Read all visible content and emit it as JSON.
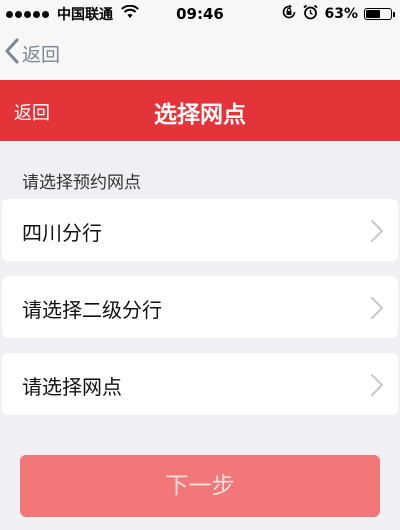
{
  "status_bar": {
    "carrier": "中国联通",
    "time": "09:46",
    "battery_percent": "63%",
    "battery_level": 0.63,
    "icons": [
      "signal-dots-icon",
      "wifi-icon",
      "rotation-lock-icon",
      "alarm-icon",
      "battery-icon"
    ]
  },
  "browser_nav": {
    "back_label": "返回"
  },
  "app_bar": {
    "back_label": "返回",
    "title": "选择网点",
    "color": "#e43339"
  },
  "section_label": "请选择预约网点",
  "rows": [
    {
      "label": "四川分行"
    },
    {
      "label": "请选择二级分行"
    },
    {
      "label": "请选择网点"
    }
  ],
  "next_button": {
    "label": "下一步",
    "color": "#f27779"
  }
}
